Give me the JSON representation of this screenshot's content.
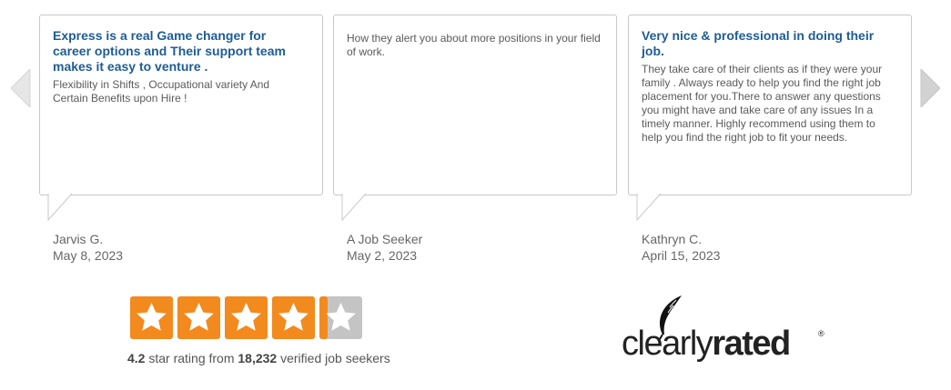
{
  "reviews": [
    {
      "title": "Express is a real Game changer for career options and Their support team makes it easy to venture .",
      "body": "Flexibility in Shifts , Occupational variety And Certain Benefits upon Hire !",
      "author": "Jarvis G.",
      "date": "May 8, 2023"
    },
    {
      "title": "",
      "body": "How they alert you about more positions in your field of work.",
      "author": "A Job Seeker",
      "date": "May 2, 2023"
    },
    {
      "title": "Very nice & professional in doing their job.",
      "body": "They take care of their clients as if they were your family . Always ready to help you find the right job placement for you.There to answer any questions you might have and take care of any issues In a timely manner. Highly recommend using them to help you find the right job to fit your needs.",
      "author": "Kathryn C.",
      "date": "April 15, 2023"
    }
  ],
  "rating": {
    "value": "4.2",
    "value_fraction_of_5": 0.84,
    "mid_text": " star rating from ",
    "count": "18,232",
    "suffix": " verified job seekers",
    "star_color": "#f28a1e",
    "empty_color": "#c4c4c4"
  },
  "logo": {
    "part1": "clearly",
    "part2": "rated",
    "registered": "®",
    "icon": "feather-icon"
  },
  "nav": {
    "prev_icon": "chevron-left-icon",
    "next_icon": "chevron-right-icon"
  },
  "colors": {
    "title_blue": "#1e5c94",
    "card_border": "#c8c8c8"
  }
}
